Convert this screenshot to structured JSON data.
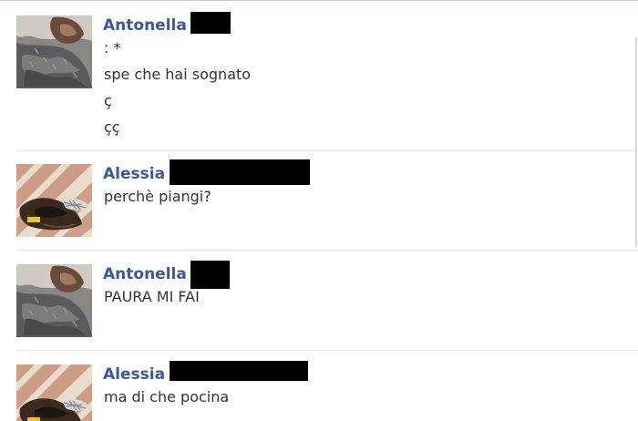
{
  "messages": [
    {
      "author": "Antonella",
      "avatar": "antonella-avatar",
      "lines": [
        ": *",
        "spe che hai sognato",
        "ç",
        "çç"
      ]
    },
    {
      "author": "Alessia",
      "avatar": "alessia-avatar",
      "lines": [
        "perchè piangi?"
      ]
    },
    {
      "author": "Antonella",
      "avatar": "antonella-avatar",
      "lines": [
        "PAURA MI FAI"
      ]
    },
    {
      "author": "Alessia",
      "avatar": "alessia-avatar",
      "lines": [
        "ma di che pocina"
      ]
    }
  ],
  "colors": {
    "author": "#3b5998",
    "text": "#333333",
    "separator": "#e4e6eb",
    "redaction": "#000000"
  }
}
